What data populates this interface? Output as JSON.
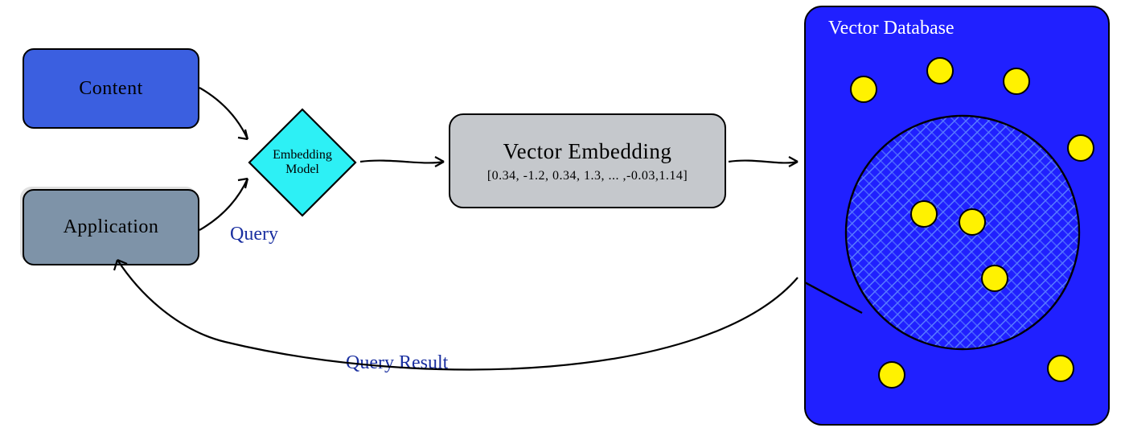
{
  "content": {
    "label": "Content"
  },
  "application": {
    "label": "Application"
  },
  "embedding_model": {
    "label": "Embedding\nModel"
  },
  "query_label": "Query",
  "vector_embedding": {
    "title": "Vector Embedding",
    "values": "[0.34, -1.2, 0.34, 1.3, ... ,-0.03,1.14]"
  },
  "query_result_label": "Query Result",
  "vector_database": {
    "title": "Vector Database"
  }
}
